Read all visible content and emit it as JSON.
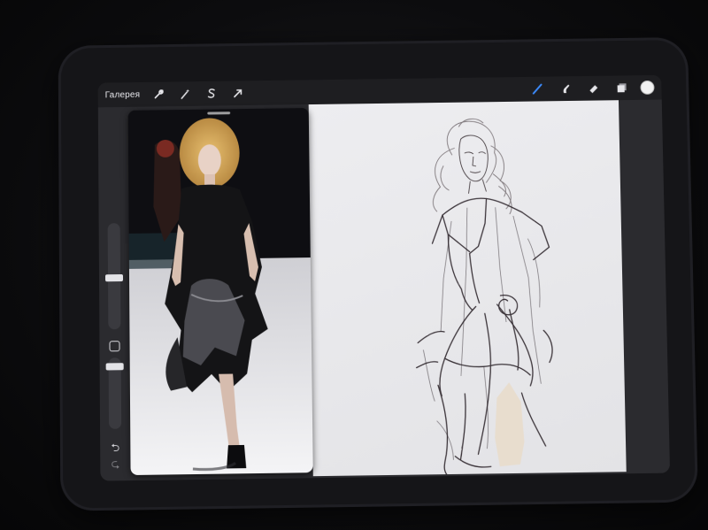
{
  "toolbar": {
    "gallery_label": "Галерея",
    "left_tools": [
      {
        "icon": "wrench-icon",
        "name": "actions"
      },
      {
        "icon": "magic-wand-icon",
        "name": "adjustments"
      },
      {
        "icon": "selection-s-icon",
        "name": "selection"
      },
      {
        "icon": "arrow-cursor-icon",
        "name": "transform"
      }
    ],
    "right_tools": [
      {
        "icon": "brush-icon",
        "name": "brush",
        "active": true
      },
      {
        "icon": "smudge-icon",
        "name": "smudge"
      },
      {
        "icon": "eraser-icon",
        "name": "eraser"
      },
      {
        "icon": "layers-icon",
        "name": "layers"
      }
    ],
    "current_color": "#f2f2f2",
    "active_color": "#3c8cff"
  },
  "sidebar": {
    "size_slider": 0.55,
    "opacity_slider": 0.9
  },
  "reference": {
    "description_icon": "fashion-runway-photo"
  },
  "canvas": {
    "background": "#e9e9ec",
    "stroke_color": "#2a2228"
  }
}
